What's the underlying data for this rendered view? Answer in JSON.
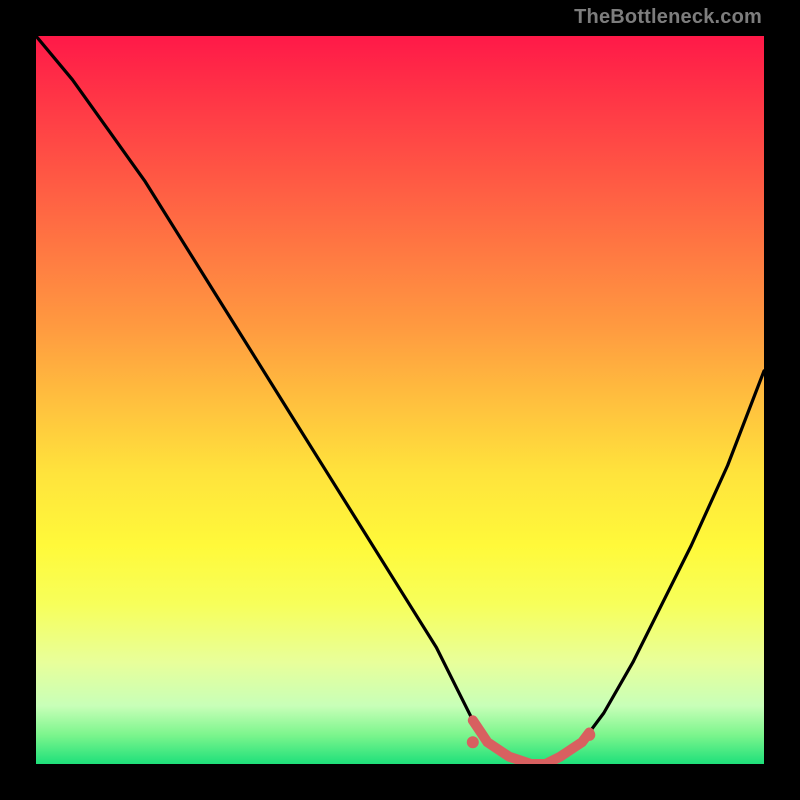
{
  "watermark": "TheBottleneck.com",
  "chart_data": {
    "type": "line",
    "title": "",
    "xlabel": "",
    "ylabel": "",
    "xlim": [
      0,
      100
    ],
    "ylim": [
      0,
      100
    ],
    "series": [
      {
        "name": "bottleneck-curve",
        "x": [
          0,
          5,
          10,
          15,
          20,
          25,
          30,
          35,
          40,
          45,
          50,
          55,
          58,
          60,
          62,
          65,
          68,
          70,
          72,
          75,
          78,
          82,
          86,
          90,
          95,
          100
        ],
        "y": [
          100,
          94,
          87,
          80,
          72,
          64,
          56,
          48,
          40,
          32,
          24,
          16,
          10,
          6,
          3,
          1,
          0,
          0,
          1,
          3,
          7,
          14,
          22,
          30,
          41,
          54
        ]
      }
    ],
    "markers": [
      {
        "name": "range-start",
        "x": 60,
        "y": 3,
        "color": "#d86060",
        "r": 6
      },
      {
        "name": "range-end",
        "x": 76,
        "y": 4,
        "color": "#d86060",
        "r": 6
      }
    ],
    "highlight_band": {
      "x_from": 60,
      "x_to": 76,
      "color": "#d86060",
      "thickness": 10
    },
    "background_gradient": {
      "direction": "top-to-bottom",
      "stops": [
        {
          "pos": 0,
          "color": "#ff1948"
        },
        {
          "pos": 50,
          "color": "#ffbf3e"
        },
        {
          "pos": 78,
          "color": "#f7ff5a"
        },
        {
          "pos": 100,
          "color": "#1ee07a"
        }
      ]
    },
    "grid": false,
    "legend": false
  }
}
